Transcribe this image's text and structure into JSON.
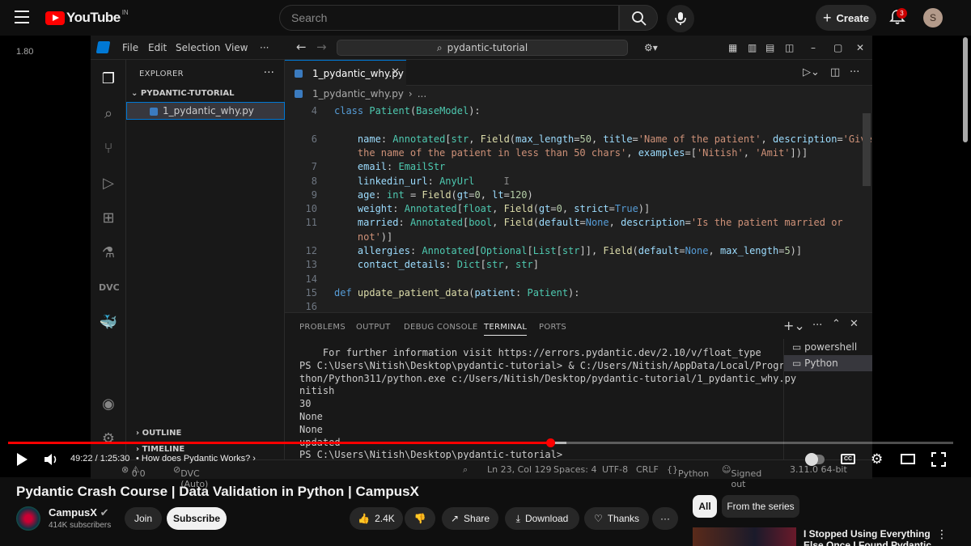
{
  "youtube": {
    "logo": "YouTube",
    "country": "IN",
    "search_placeholder": "Search",
    "create_label": "Create",
    "notif_count": "3",
    "avatar_letter": "S",
    "speed": "1.80"
  },
  "vscode": {
    "menu": [
      "File",
      "Edit",
      "Selection",
      "View",
      "···"
    ],
    "command_center": "pydantic-tutorial",
    "explorer_title": "EXPLORER",
    "project": "PYDANTIC-TUTORIAL",
    "file": "1_pydantic_why.py",
    "outline": "OUTLINE",
    "timeline": "TIMELINE",
    "tab": "1_pydantic_why.py",
    "breadcrumb": "1_pydantic_why.py",
    "breadcrumb_more": "...",
    "code_lines": [
      {
        "n": "4",
        "html": "<span class='kw'>class</span> <span class='cls'>Patient</span>(<span class='cls'>BaseModel</span>):"
      },
      {
        "n": "",
        "html": ""
      },
      {
        "n": "6",
        "html": "    <span class='var'>name</span>: <span class='cls'>Annotated</span>[<span class='cls'>str</span>, <span class='fn'>Field</span>(<span class='var'>max_length</span>=<span class='num'>50</span>, <span class='var'>title</span>=<span class='str'>'Name of the patient'</span>, <span class='var'>description</span>=<span class='str'>'Give</span>"
      },
      {
        "n": "",
        "html": "<span class='str'>    the name of the patient in less than 50 chars'</span>, <span class='var'>examples</span>=[<span class='str'>'Nitish'</span>, <span class='str'>'Amit'</span>])]"
      },
      {
        "n": "7",
        "html": "    <span class='var'>email</span>: <span class='cls'>EmailStr</span>"
      },
      {
        "n": "8",
        "html": "    <span class='var'>linkedin_url</span>: <span class='cls'>AnyUrl</span>     <span style='color:#888'>I</span>"
      },
      {
        "n": "9",
        "html": "    <span class='var'>age</span>: <span class='cls'>int</span> = <span class='fn'>Field</span>(<span class='var'>gt</span>=<span class='num'>0</span>, <span class='var'>lt</span>=<span class='num'>120</span>)"
      },
      {
        "n": "10",
        "html": "    <span class='var'>weight</span>: <span class='cls'>Annotated</span>[<span class='cls'>float</span>, <span class='fn'>Field</span>(<span class='var'>gt</span>=<span class='num'>0</span>, <span class='var'>strict</span>=<span class='kw'>True</span>)]"
      },
      {
        "n": "11",
        "html": "    <span class='var'>married</span>: <span class='cls'>Annotated</span>[<span class='cls'>bool</span>, <span class='fn'>Field</span>(<span class='var'>default</span>=<span class='kw'>None</span>, <span class='var'>description</span>=<span class='str'>'Is the patient married or</span>"
      },
      {
        "n": "",
        "html": "<span class='str'>    not'</span>)]"
      },
      {
        "n": "12",
        "html": "    <span class='var'>allergies</span>: <span class='cls'>Annotated</span>[<span class='cls'>Optional</span>[<span class='cls'>List</span>[<span class='cls'>str</span>]], <span class='fn'>Field</span>(<span class='var'>default</span>=<span class='kw'>None</span>, <span class='var'>max_length</span>=<span class='num'>5</span>)]"
      },
      {
        "n": "13",
        "html": "    <span class='var'>contact_details</span>: <span class='cls'>Dict</span>[<span class='cls'>str</span>, <span class='cls'>str</span>]"
      },
      {
        "n": "14",
        "html": ""
      },
      {
        "n": "15",
        "html": "<span class='kw'>def</span> <span class='fn'>update_patient_data</span>(<span class='var'>patient</span>: <span class='cls'>Patient</span>):"
      },
      {
        "n": "16",
        "html": ""
      }
    ],
    "panel_tabs": [
      "PROBLEMS",
      "OUTPUT",
      "DEBUG CONSOLE",
      "TERMINAL",
      "PORTS"
    ],
    "terminal_lines": [
      "    For further information visit https://errors.pydantic.dev/2.10/v/float_type",
      "PS C:\\Users\\Nitish\\Desktop\\pydantic-tutorial> & C:/Users/Nitish/AppData/Local/Programs/Py",
      "thon/Python311/python.exe c:/Users/Nitish/Desktop/pydantic-tutorial/1_pydantic_why.py",
      "nitish",
      "30",
      "None",
      "None",
      "updated",
      "PS C:\\Users\\Nitish\\Desktop\\pydantic-tutorial> "
    ],
    "terminals": [
      "powershell",
      "Python"
    ],
    "status": {
      "errors": "0",
      "warnings": "0",
      "dvc": "DVC (Auto)",
      "position": "Ln 23, Col 129",
      "spaces": "Spaces: 4",
      "encoding": "UTF-8",
      "eol": "CRLF",
      "language": "Python",
      "signed": "Signed out",
      "interpreter": "3.11.0 64-bit"
    }
  },
  "player": {
    "time": "49:22 / 1:25:30",
    "chapter": "How does Pydantic Works?",
    "progress": 0.574
  },
  "video": {
    "title": "Pydantic Crash Course | Data Validation in Python | CampusX",
    "channel": "CampusX",
    "subscribers": "414K subscribers",
    "join": "Join",
    "subscribe": "Subscribe",
    "likes": "2.4K",
    "share": "Share",
    "download": "Download",
    "thanks": "Thanks",
    "more": "···"
  },
  "recommend": {
    "chips": [
      "All",
      "From the series"
    ],
    "item_title": "I Stopped Using Everything Else Once I Found Pydantic"
  }
}
